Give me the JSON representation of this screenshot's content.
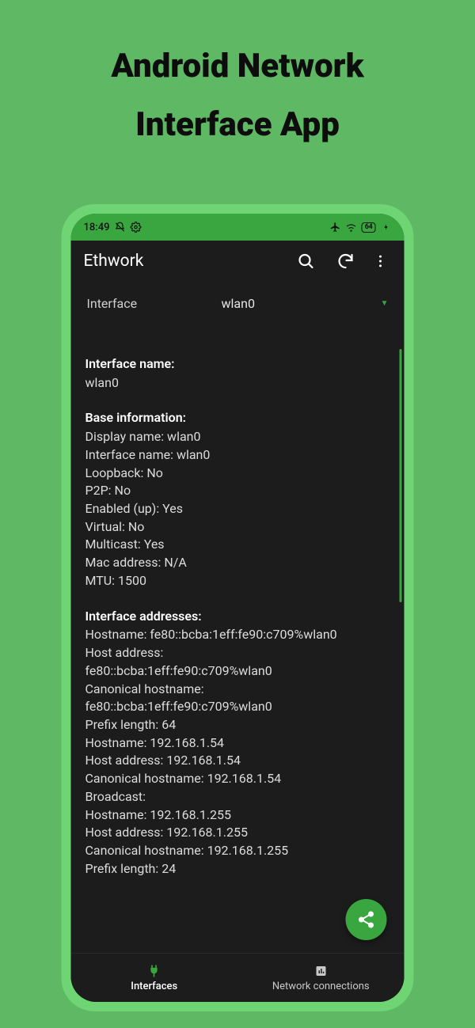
{
  "promo": {
    "line1": "Android Network",
    "line2": "Interface App"
  },
  "status": {
    "time": "18:49",
    "battery": "64"
  },
  "appbar": {
    "title": "Ethwork"
  },
  "dropdown": {
    "label": "Interface",
    "value": "wlan0"
  },
  "sections": {
    "ifname": {
      "header": "Interface name:",
      "value": "wlan0"
    },
    "base": {
      "header": "Base information:",
      "lines": [
        "Display name: wlan0",
        "Interface name: wlan0",
        "Loopback: No",
        "P2P: No",
        "Enabled (up): Yes",
        "Virtual: No",
        "Multicast: Yes",
        "Mac address: N/A",
        "MTU: 1500"
      ]
    },
    "addr": {
      "header": "Interface addresses:",
      "lines": [
        "Hostname: fe80::bcba:1eff:fe90:c709%wlan0",
        "Host address:",
        "fe80::bcba:1eff:fe90:c709%wlan0",
        "Canonical hostname:",
        "fe80::bcba:1eff:fe90:c709%wlan0",
        "Prefix length: 64",
        "Hostname: 192.168.1.54",
        "Host address: 192.168.1.54",
        "Canonical hostname: 192.168.1.54",
        "Broadcast:",
        "Hostname: 192.168.1.255",
        "Host address: 192.168.1.255",
        "Canonical hostname: 192.168.1.255",
        "Prefix length: 24"
      ]
    }
  },
  "nav": {
    "interfaces": "Interfaces",
    "connections": "Network connections"
  }
}
